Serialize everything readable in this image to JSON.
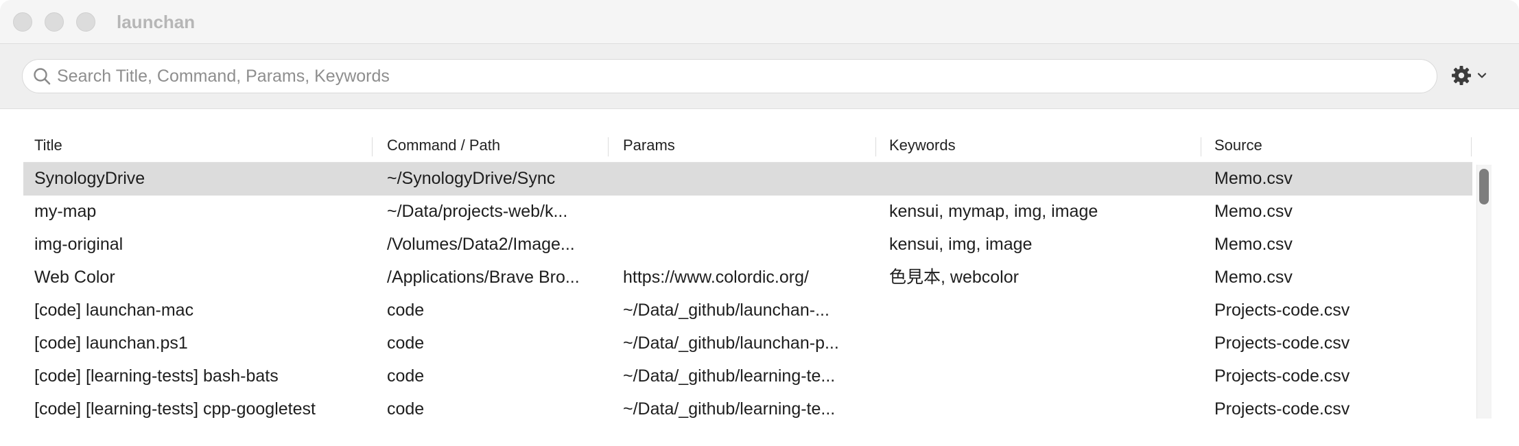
{
  "window": {
    "title": "launchan"
  },
  "search": {
    "placeholder": "Search Title, Command, Params, Keywords",
    "value": ""
  },
  "settings": {
    "icon": "gear-icon",
    "dropdown_icon": "chevron-down-icon"
  },
  "table": {
    "headers": {
      "title": "Title",
      "command": "Command / Path",
      "params": "Params",
      "keywords": "Keywords",
      "source": "Source"
    },
    "rows": [
      {
        "title": "SynologyDrive",
        "command": "~/SynologyDrive/Sync",
        "params": "",
        "keywords": "",
        "source": "Memo.csv",
        "selected": true
      },
      {
        "title": "my-map",
        "command": "~/Data/projects-web/k...",
        "params": "",
        "keywords": "kensui, mymap, img, image",
        "source": "Memo.csv",
        "selected": false
      },
      {
        "title": "img-original",
        "command": "/Volumes/Data2/Image...",
        "params": "",
        "keywords": "kensui, img, image",
        "source": "Memo.csv",
        "selected": false
      },
      {
        "title": "Web Color",
        "command": "/Applications/Brave Bro...",
        "params": "https://www.colordic.org/",
        "keywords": "色見本, webcolor",
        "source": "Memo.csv",
        "selected": false
      },
      {
        "title": "[code] launchan-mac",
        "command": "code",
        "params": "~/Data/_github/launchan-...",
        "keywords": "",
        "source": "Projects-code.csv",
        "selected": false
      },
      {
        "title": "[code] launchan.ps1",
        "command": "code",
        "params": "~/Data/_github/launchan-p...",
        "keywords": "",
        "source": "Projects-code.csv",
        "selected": false
      },
      {
        "title": "[code] [learning-tests] bash-bats",
        "command": "code",
        "params": "~/Data/_github/learning-te...",
        "keywords": "",
        "source": "Projects-code.csv",
        "selected": false
      },
      {
        "title": "[code] [learning-tests] cpp-googletest",
        "command": "code",
        "params": "~/Data/_github/learning-te...",
        "keywords": "",
        "source": "Projects-code.csv",
        "selected": false
      }
    ]
  },
  "colors": {
    "selected_row": "#dcdcdc",
    "toolbar_bg": "#efefef",
    "titlebar_bg": "#f5f5f5",
    "scroll_thumb": "#7d7d7d"
  }
}
